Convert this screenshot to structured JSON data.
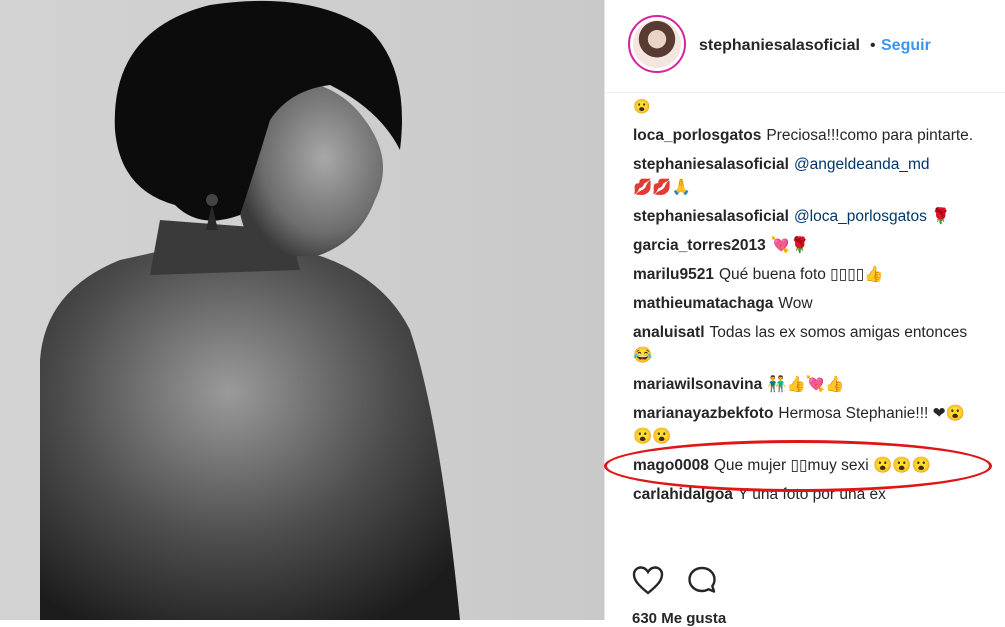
{
  "post": {
    "username": "stephaniesalasoficial",
    "separator": "•",
    "follow_label": "Seguir",
    "top_emoji": "😮",
    "likes_text": "630 Me gusta"
  },
  "comments": [
    {
      "user": "loca_porlosgatos",
      "text": "Preciosa!!!como para pintarte."
    },
    {
      "user": "stephaniesalasoficial",
      "mention": "@angeldeanda_md",
      "text": "💋💋🙏"
    },
    {
      "user": "stephaniesalasoficial",
      "mention": "@loca_porlosgatos",
      "text": "🌹"
    },
    {
      "user": "garcia_torres2013",
      "text": "💘🌹"
    },
    {
      "user": "marilu9521",
      "text": "Qué buena foto ▯▯▯▯👍"
    },
    {
      "user": "mathieumatachaga",
      "text": "Wow"
    },
    {
      "user": "analuisatl",
      "text": "Todas las ex somos amigas entonces 😂"
    },
    {
      "user": "mariawilsonavina",
      "text": "👬👍💘👍"
    },
    {
      "user": "marianayazbekfoto",
      "text": "Hermosa Stephanie!!! ❤😮😮😮"
    },
    {
      "user": "mago0008",
      "text": "Que mujer ▯▯muy sexi 😮😮😮"
    },
    {
      "user": "carlahidalgoa",
      "text": "Y una foto por una ex"
    }
  ],
  "icons": {
    "like": "heart-icon",
    "comment": "comment-bubble-icon"
  },
  "colors": {
    "link": "#3897f0",
    "highlight": "#e01616",
    "text": "#262626"
  }
}
